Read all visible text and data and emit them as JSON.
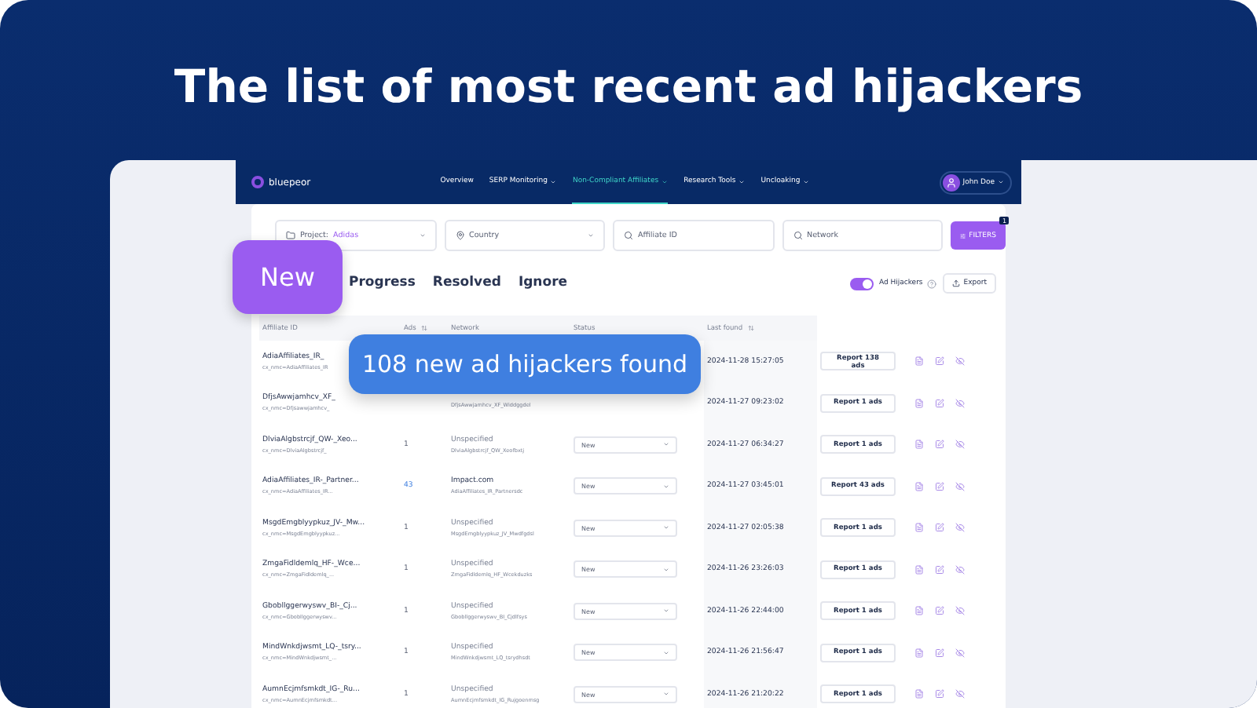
{
  "headline": "The list of most recent ad hijackers",
  "nav": {
    "logo": "bluepeor",
    "items": [
      {
        "label": "Overview",
        "dropdown": false,
        "selected": false
      },
      {
        "label": "SERP Monitoring",
        "dropdown": true,
        "selected": false
      },
      {
        "label": "Non-Compliant Affiliates",
        "dropdown": true,
        "selected": true
      },
      {
        "label": "Research Tools",
        "dropdown": true,
        "selected": false
      },
      {
        "label": "Uncloaking",
        "dropdown": true,
        "selected": false
      }
    ],
    "user": "John Doe"
  },
  "filters": {
    "project_label": "Project:",
    "project_value": "Adidas",
    "country": "Country",
    "affiliate_placeholder": "Affiliate ID",
    "network_placeholder": "Network",
    "button": "FILTERS",
    "badge": "1"
  },
  "tabs": [
    {
      "label": "Progress",
      "selected": false
    },
    {
      "label": "Resolved",
      "selected": false
    },
    {
      "label": "Ignore",
      "selected": false
    }
  ],
  "toggle": {
    "label": "Ad Hijackers",
    "on": true
  },
  "export": "Export",
  "columns": [
    "Affiliate ID",
    "Ads",
    "Network",
    "Status",
    "Last found"
  ],
  "rows": [
    {
      "id": "AdiaAffiliates_IR_",
      "sub": "cx_nmc=AdiaAffiliates_IR",
      "date": "2024-11-28 15:27:05",
      "report": "Report 138 ads"
    },
    {
      "id": "DfjsAwwjamhcv_XF_",
      "sub": "cx_nmc=Dfjsawwjamhcv_",
      "network_sub": "DfjsAwwjamhcv_XF_Widdggdel",
      "date": "2024-11-27 09:23:02",
      "report": "Report 1 ads"
    },
    {
      "id": "DlviaAlgbstrcjf_QW-_Xeo...",
      "sub": "cx_nmc=DlviaAlgbstrcjf_",
      "ads": "1",
      "network": "Unspecified",
      "specified": false,
      "network_sub": "DlviaAlgbstrcjf_QW_Xeofbxtj",
      "status": "New",
      "date": "2024-11-27 06:34:27",
      "report": "Report 1 ads"
    },
    {
      "id": "AdiaAffiliates_IR-_Partner...",
      "sub": "cx_nmc=AdiaAffiliates_IR...",
      "ads": "43",
      "network": "Impact.com",
      "specified": true,
      "network_sub": "AdiaAffiliates_IR_Partnersdc",
      "status": "New",
      "date": "2024-11-27 03:45:01",
      "report": "Report 43 ads"
    },
    {
      "id": "MsgdEmgblyypkuz_JV-_Mw...",
      "sub": "cx_nmc=MsgdEmgblyypkuz...",
      "ads": "1",
      "network": "Unspecified",
      "specified": false,
      "network_sub": "MsgdEmgblyypkuz_JV_Mwdfgdsl",
      "status": "New",
      "date": "2024-11-27 02:05:38",
      "report": "Report 1 ads"
    },
    {
      "id": "ZmgaFidldemlq_HF-_Wce...",
      "sub": "cx_nmc=ZmgaFidldemlq_...",
      "ads": "1",
      "network": "Unspecified",
      "specified": false,
      "network_sub": "ZmgaFidldemlq_HF_Wcekduzks",
      "status": "New",
      "date": "2024-11-26 23:26:03",
      "report": "Report 1 ads"
    },
    {
      "id": "Gbobllggerwyswv_BI-_Cj...",
      "sub": "cx_nmc=Gbobllggerwyswv...",
      "ads": "1",
      "network": "Unspecified",
      "specified": false,
      "network_sub": "Gbobllggerwyswv_BI_Cjdlfsys",
      "status": "New",
      "date": "2024-11-26 22:44:00",
      "report": "Report 1 ads"
    },
    {
      "id": "MindWnkdjwsmt_LQ-_tsry...",
      "sub": "cx_nmc=MindWnkdjwsmt_...",
      "ads": "1",
      "network": "Unspecified",
      "specified": false,
      "network_sub": "MindWnkdjwsmt_LQ_tsrydhsdt",
      "status": "New",
      "date": "2024-11-26 21:56:47",
      "report": "Report 1 ads"
    },
    {
      "id": "AumnEcjmfsmkdt_IG-_Ru...",
      "sub": "cx_nmc=AumnEcjmfsmkdt...",
      "ads": "1",
      "network": "Unspecified",
      "specified": false,
      "network_sub": "AumnEcjmfsmkdt_IG_Rujgoenmsg",
      "status": "New",
      "date": "2024-11-26 21:20:22",
      "report": "Report 1 ads"
    }
  ],
  "callouts": {
    "tag": "New",
    "message": "108 new ad hijackers found"
  }
}
